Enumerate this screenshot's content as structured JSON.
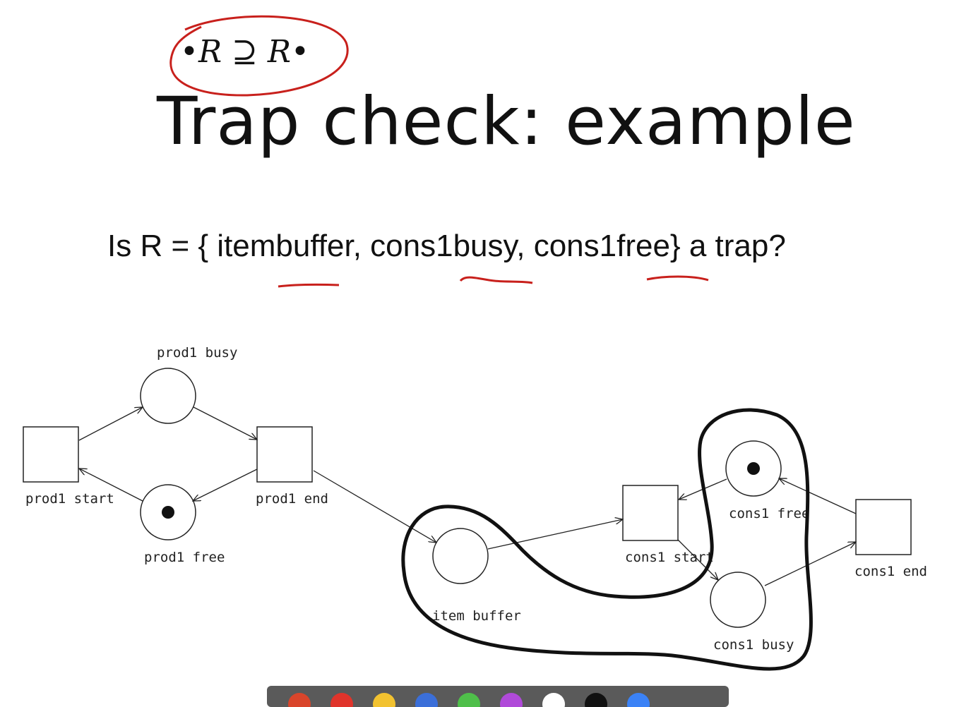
{
  "slide": {
    "formula": "•R ⊇ R•",
    "title": "Trap check: example",
    "question": "Is R = { itembuffer, cons1busy, cons1free} a trap?"
  },
  "petri_net": {
    "places": [
      {
        "id": "prod1_busy",
        "label": "prod1 busy",
        "token": false
      },
      {
        "id": "prod1_free",
        "label": "prod1 free",
        "token": true
      },
      {
        "id": "item_buffer",
        "label": "item buffer",
        "token": false
      },
      {
        "id": "cons1_free",
        "label": "cons1 free",
        "token": true
      },
      {
        "id": "cons1_busy",
        "label": "cons1 busy",
        "token": false
      }
    ],
    "transitions": [
      {
        "id": "prod1_start",
        "label": "prod1 start"
      },
      {
        "id": "prod1_end",
        "label": "prod1 end"
      },
      {
        "id": "cons1_start",
        "label": "cons1 start"
      },
      {
        "id": "cons1_end",
        "label": "cons1 end"
      }
    ]
  },
  "colors": {
    "annotation": "#c8201c",
    "ink": "#111111",
    "toolbar": "#5a5a5a"
  },
  "toolbar": {
    "swatches": [
      "#d9452b",
      "#e0342b",
      "#f2c230",
      "#3b6fd9",
      "#4fbf4a",
      "#b04ad9",
      "#ffffff",
      "#111111",
      "#3b82f6"
    ]
  }
}
